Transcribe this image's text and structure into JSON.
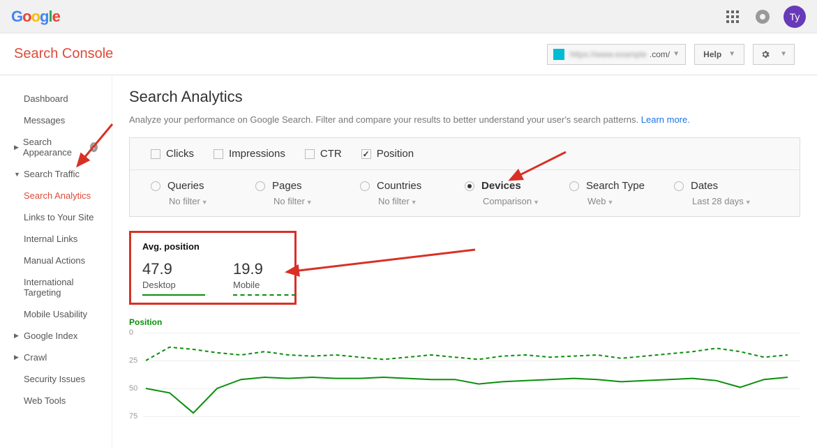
{
  "header": {
    "avatar": "Ty"
  },
  "subheader": {
    "title": "Search Console",
    "site_blur": "https://www.example",
    "site_domain": ".com/",
    "help": "Help"
  },
  "sidebar": {
    "dashboard": "Dashboard",
    "messages": "Messages",
    "search_appearance": "Search Appearance",
    "search_traffic": "Search Traffic",
    "search_analytics": "Search Analytics",
    "links_to_site": "Links to Your Site",
    "internal_links": "Internal Links",
    "manual_actions": "Manual Actions",
    "intl_targeting": "International Targeting",
    "mobile_usability": "Mobile Usability",
    "google_index": "Google Index",
    "crawl": "Crawl",
    "security": "Security Issues",
    "web_tools": "Web Tools"
  },
  "page": {
    "title": "Search Analytics",
    "desc": "Analyze your performance on Google Search. Filter and compare your results to better understand your user's search patterns. ",
    "learn": "Learn more."
  },
  "metrics": {
    "clicks": "Clicks",
    "impressions": "Impressions",
    "ctr": "CTR",
    "position": "Position"
  },
  "dims": {
    "queries": {
      "label": "Queries",
      "sub": "No filter"
    },
    "pages": {
      "label": "Pages",
      "sub": "No filter"
    },
    "countries": {
      "label": "Countries",
      "sub": "No filter"
    },
    "devices": {
      "label": "Devices",
      "sub": "Comparison"
    },
    "search_type": {
      "label": "Search Type",
      "sub": "Web"
    },
    "dates": {
      "label": "Dates",
      "sub": "Last 28 days"
    }
  },
  "stats": {
    "title": "Avg. position",
    "desktop_val": "47.9",
    "desktop_label": "Desktop",
    "mobile_val": "19.9",
    "mobile_label": "Mobile"
  },
  "chart": {
    "title": "Position",
    "ticks": [
      "0",
      "25",
      "50",
      "75"
    ]
  },
  "chart_data": {
    "type": "line",
    "ylabel": "Position",
    "ylim": [
      0,
      75
    ],
    "y_inverted": true,
    "x_count": 28,
    "series": [
      {
        "name": "Desktop",
        "style": "solid",
        "color": "#0a8f0a",
        "values": [
          50,
          54,
          72,
          50,
          42,
          40,
          41,
          40,
          41,
          41,
          40,
          41,
          42,
          42,
          46,
          44,
          43,
          42,
          41,
          42,
          44,
          43,
          42,
          41,
          43,
          49,
          42,
          40
        ]
      },
      {
        "name": "Mobile",
        "style": "dashed",
        "color": "#0a8f0a",
        "values": [
          25,
          13,
          15,
          18,
          20,
          17,
          20,
          21,
          20,
          22,
          24,
          22,
          20,
          22,
          24,
          21,
          20,
          22,
          21,
          20,
          23,
          21,
          19,
          17,
          14,
          17,
          22,
          20
        ]
      }
    ]
  }
}
